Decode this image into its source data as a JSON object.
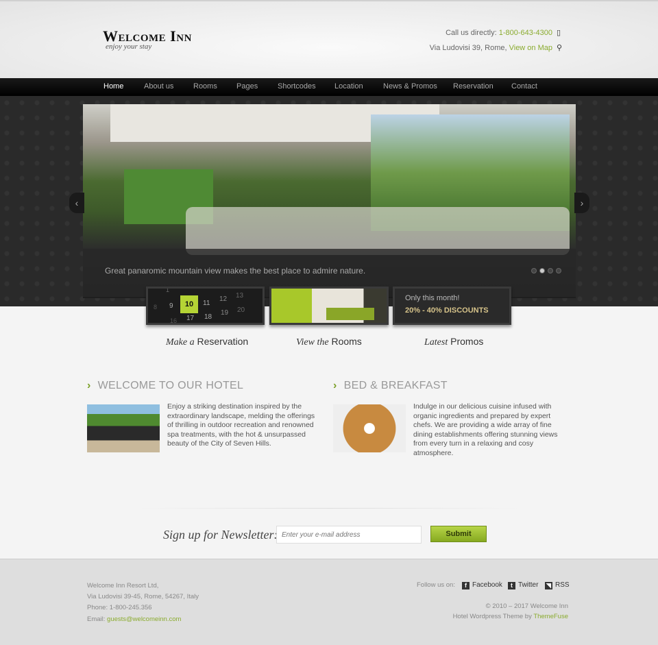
{
  "header": {
    "logo_title": "Welcome Inn",
    "logo_tagline": "enjoy your stay",
    "call_label": "Call us directly: ",
    "phone": "1-800-643-4300",
    "address": "Via Ludovisi 39, Rome, ",
    "map_link": "View on Map",
    "phone_icon": "mobile-phone-icon",
    "map_icon": "map-pin-icon"
  },
  "nav": {
    "items": [
      "Home",
      "About us",
      "Rooms",
      "Pages",
      "Shortcodes",
      "Location",
      "News & Promos",
      "Reservation",
      "Contact"
    ],
    "active": "Home"
  },
  "slider": {
    "caption": "Great panaromic mountain view makes the best place to admire nature.",
    "prev": "‹",
    "next": "›",
    "slide_count": 4,
    "active_slide": 2
  },
  "features": [
    {
      "script": "Make a",
      "label": " Reservation",
      "calendar": [
        "1",
        "8",
        "9",
        "10",
        "11",
        "12",
        "13",
        "16",
        "17",
        "18",
        "19",
        "20"
      ]
    },
    {
      "script": "View the",
      "label": " Rooms"
    },
    {
      "script": "Latest",
      "label": " Promos",
      "promo_line1": "Only this month!",
      "promo_line2": "20% - 40% DISCOUNTS"
    }
  ],
  "sections": [
    {
      "title": "WELCOME TO OUR HOTEL",
      "text": "Enjoy a striking destination inspired by the extraordinary landscape, melding the offerings of thrilling in outdoor recreation and renowned spa treatments, with the hot & unsurpassed beauty of the City of Seven Hills."
    },
    {
      "title": "BED & BREAKFAST",
      "text": "Indulge in our delicious cuisine infused with organic ingredients and prepared by expert chefs. We are providing a wide array of fine dining establishments offering stunning views from every turn in a relaxing and cosy atmosphere."
    }
  ],
  "newsletter": {
    "label": "Sign up for Newsletter:",
    "placeholder": "Enter your e-mail address",
    "button": "Submit"
  },
  "footer": {
    "company": "Welcome Inn Resort Ltd,",
    "address": "Via Ludovisi 39-45, Rome, 54267, Italy",
    "phone": "Phone: 1-800-245.356",
    "email_label": "Email: ",
    "email": "guests@welcomeinn.com",
    "follow": "Follow us on:",
    "facebook": "Facebook",
    "twitter": "Twitter",
    "rss": "RSS",
    "copyright": "© 2010 – 2017 Welcome Inn",
    "theme_by": "Hotel Wordpress Theme by ",
    "theme_link": "ThemeFuse"
  },
  "colors": {
    "accent": "#8aab2e",
    "nav_bg": "#000000",
    "footer_bg": "#dedede"
  }
}
